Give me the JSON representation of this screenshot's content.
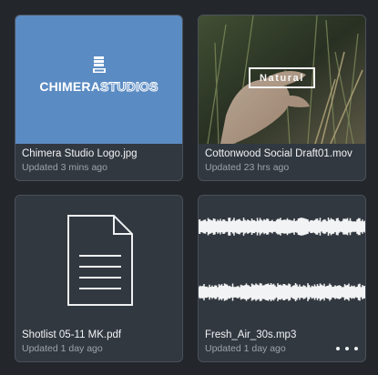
{
  "files": [
    {
      "name": "Chimera Studio Logo.jpg",
      "updated": "Updated 3 mins ago",
      "kind": "image",
      "logo": {
        "text_solid": "CHIMERA",
        "text_outline": "STUDIOS"
      }
    },
    {
      "name": "Cottonwood Social Draft01.mov",
      "updated": "Updated 23 hrs ago",
      "kind": "video",
      "overlay_text": "Natural"
    },
    {
      "name": "Shotlist 05-11 MK.pdf",
      "updated": "Updated 1 day ago",
      "kind": "document"
    },
    {
      "name": "Fresh_Air_30s.mp3",
      "updated": "Updated 1 day ago",
      "kind": "audio"
    }
  ],
  "icons": {
    "logo": "chimera-stack-icon",
    "document": "document-icon",
    "waveform": "waveform-icon",
    "more": "more-options-icon"
  },
  "colors": {
    "background": "#23272c",
    "card": "#323840",
    "logo_bg": "#5b8bc3"
  }
}
